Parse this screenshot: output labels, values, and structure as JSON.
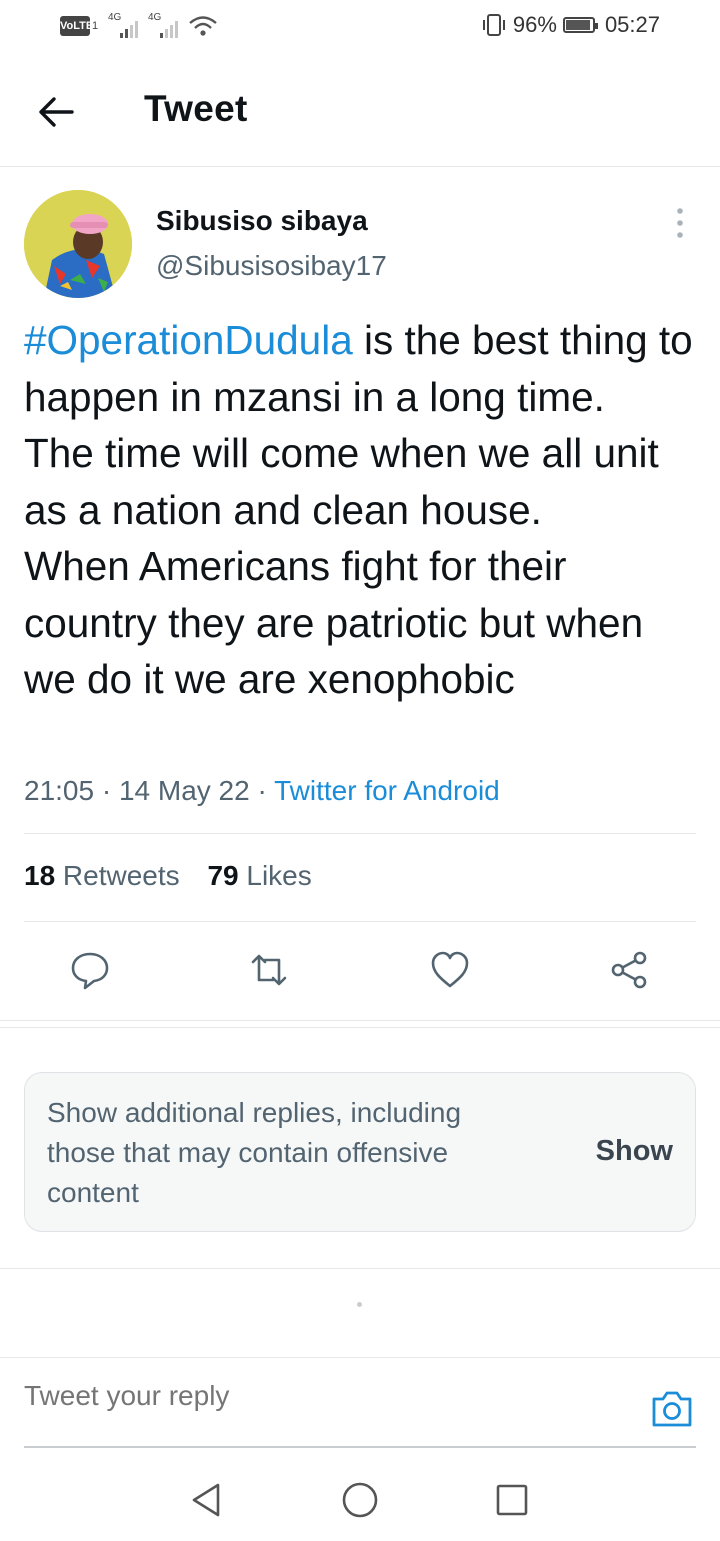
{
  "status_bar": {
    "volte": "VoLTE",
    "sim": "1",
    "net1": "4G",
    "net2": "4G",
    "battery_pct": "96%",
    "time": "05:27",
    "icons": [
      "vibrate-icon",
      "wifi-icon",
      "battery-icon"
    ]
  },
  "header": {
    "title": "Tweet",
    "back_icon": "arrow-left-icon"
  },
  "tweet": {
    "author_name": "Sibusiso sibaya",
    "author_handle": "@Sibusisosibay17",
    "hashtag": "#OperationDudula",
    "text_after_hashtag": " is the best thing to happen in mzansi in a long time.",
    "text_line2": "The time will come when we all unit as a nation and clean house.",
    "text_line3": "When Americans fight for their country they are patriotic but when we do it we are xenophobic",
    "timestamp": "21:05 · 14 May 22 · ",
    "source": "Twitter for Android",
    "retweet_count": "18",
    "retweet_label": " Retweets",
    "like_count": "79",
    "like_label": " Likes",
    "colors": {
      "link": "#1a8cd8",
      "secondary": "#536471",
      "primary": "#0f1419"
    }
  },
  "actions": [
    "reply-icon",
    "retweet-icon",
    "like-icon",
    "share-icon"
  ],
  "additional_replies": {
    "text": "Show additional replies, including those that may contain offensive content",
    "button": "Show"
  },
  "reply_bar": {
    "placeholder": "Tweet your reply",
    "icon": "camera-icon"
  },
  "nav_bar": [
    "back-triangle-icon",
    "home-circle-icon",
    "recents-square-icon"
  ]
}
